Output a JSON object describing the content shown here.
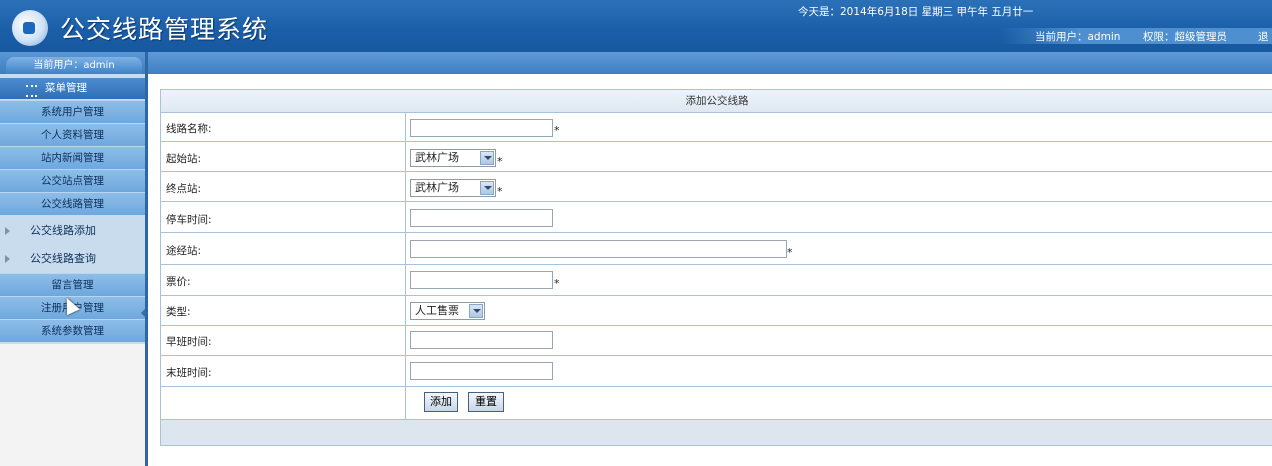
{
  "header": {
    "title": "公交线路管理系统",
    "date_text": "今天是：2014年6月18日 星期三 甲午年 五月廿一",
    "current_user_label": "当前用户：admin",
    "permission_label": "权限：超级管理员",
    "logout_partial": "退"
  },
  "sidebar": {
    "current_user": "当前用户：admin",
    "menu_title": "菜单管理",
    "items": [
      {
        "label": "系统用户管理"
      },
      {
        "label": "个人资料管理"
      },
      {
        "label": "站内新闻管理"
      },
      {
        "label": "公交站点管理"
      },
      {
        "label": "公交线路管理"
      }
    ],
    "sub_items": [
      {
        "label": "公交线路添加"
      },
      {
        "label": "公交线路查询"
      }
    ],
    "items_after": [
      {
        "label": "留言管理"
      },
      {
        "label": "注册用户管理"
      },
      {
        "label": "系统参数管理"
      }
    ]
  },
  "form": {
    "title": "添加公交线路",
    "required_mark": "*",
    "fields": {
      "route_name": {
        "label": "线路名称:",
        "value": ""
      },
      "start_station": {
        "label": "起始站:",
        "value": "武林广场"
      },
      "end_station": {
        "label": "终点站:",
        "value": "武林广场"
      },
      "stop_time": {
        "label": "停车时间:",
        "value": ""
      },
      "via_stations": {
        "label": "途经站:",
        "value": ""
      },
      "fare": {
        "label": "票价:",
        "value": ""
      },
      "type": {
        "label": "类型:",
        "value": "人工售票"
      },
      "first_bus": {
        "label": "早班时间:",
        "value": ""
      },
      "last_bus": {
        "label": "末班时间:",
        "value": ""
      }
    },
    "buttons": {
      "add": "添加",
      "reset": "重置"
    }
  }
}
